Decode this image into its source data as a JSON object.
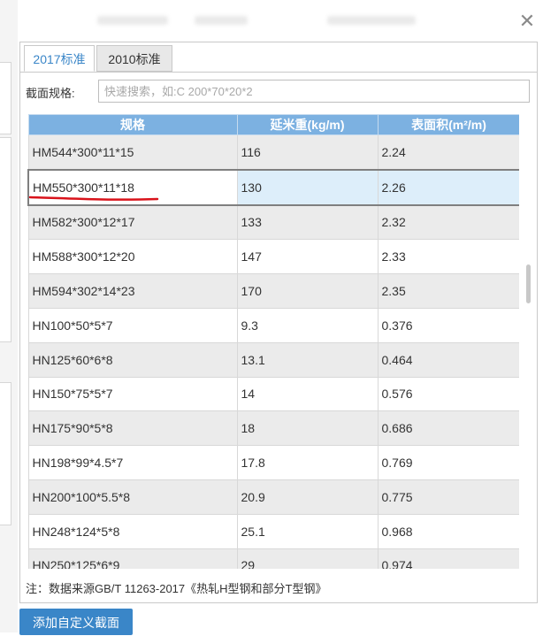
{
  "dialog": {
    "tabs": [
      {
        "label": "2017标准",
        "active": true
      },
      {
        "label": "2010标准",
        "active": false
      }
    ],
    "search": {
      "label": "截面规格:",
      "placeholder": "快速搜索，如:C 200*70*20*2",
      "value": ""
    },
    "table": {
      "headers": [
        "规格",
        "延米重(kg/m)",
        "表面积(m²/m)"
      ],
      "rows": [
        {
          "spec": "HM544*300*11*15",
          "weight": "116",
          "area": "2.24"
        },
        {
          "spec": "HM550*300*11*18",
          "weight": "130",
          "area": "2.26",
          "selected": true
        },
        {
          "spec": "HM582*300*12*17",
          "weight": "133",
          "area": "2.32"
        },
        {
          "spec": "HM588*300*12*20",
          "weight": "147",
          "area": "2.33"
        },
        {
          "spec": "HM594*302*14*23",
          "weight": "170",
          "area": "2.35"
        },
        {
          "spec": "HN100*50*5*7",
          "weight": "9.3",
          "area": "0.376"
        },
        {
          "spec": "HN125*60*6*8",
          "weight": "13.1",
          "area": "0.464"
        },
        {
          "spec": "HN150*75*5*7",
          "weight": "14",
          "area": "0.576"
        },
        {
          "spec": "HN175*90*5*8",
          "weight": "18",
          "area": "0.686"
        },
        {
          "spec": "HN198*99*4.5*7",
          "weight": "17.8",
          "area": "0.769"
        },
        {
          "spec": "HN200*100*5.5*8",
          "weight": "20.9",
          "area": "0.775"
        },
        {
          "spec": "HN248*124*5*8",
          "weight": "25.1",
          "area": "0.968"
        },
        {
          "spec": "HN250*125*6*9",
          "weight": "29",
          "area": "0.974"
        }
      ]
    },
    "footnote": "注：数据来源GB/T 11263-2017《热轧H型钢和部分T型钢》",
    "close_icon": "close-icon"
  },
  "add_button_label": "添加自定义截面",
  "colors": {
    "accent": "#3a86c8",
    "header_bg": "#7cb1e1",
    "selected_row_bg": "#ddeefa",
    "annotation_red": "#d9131b"
  }
}
